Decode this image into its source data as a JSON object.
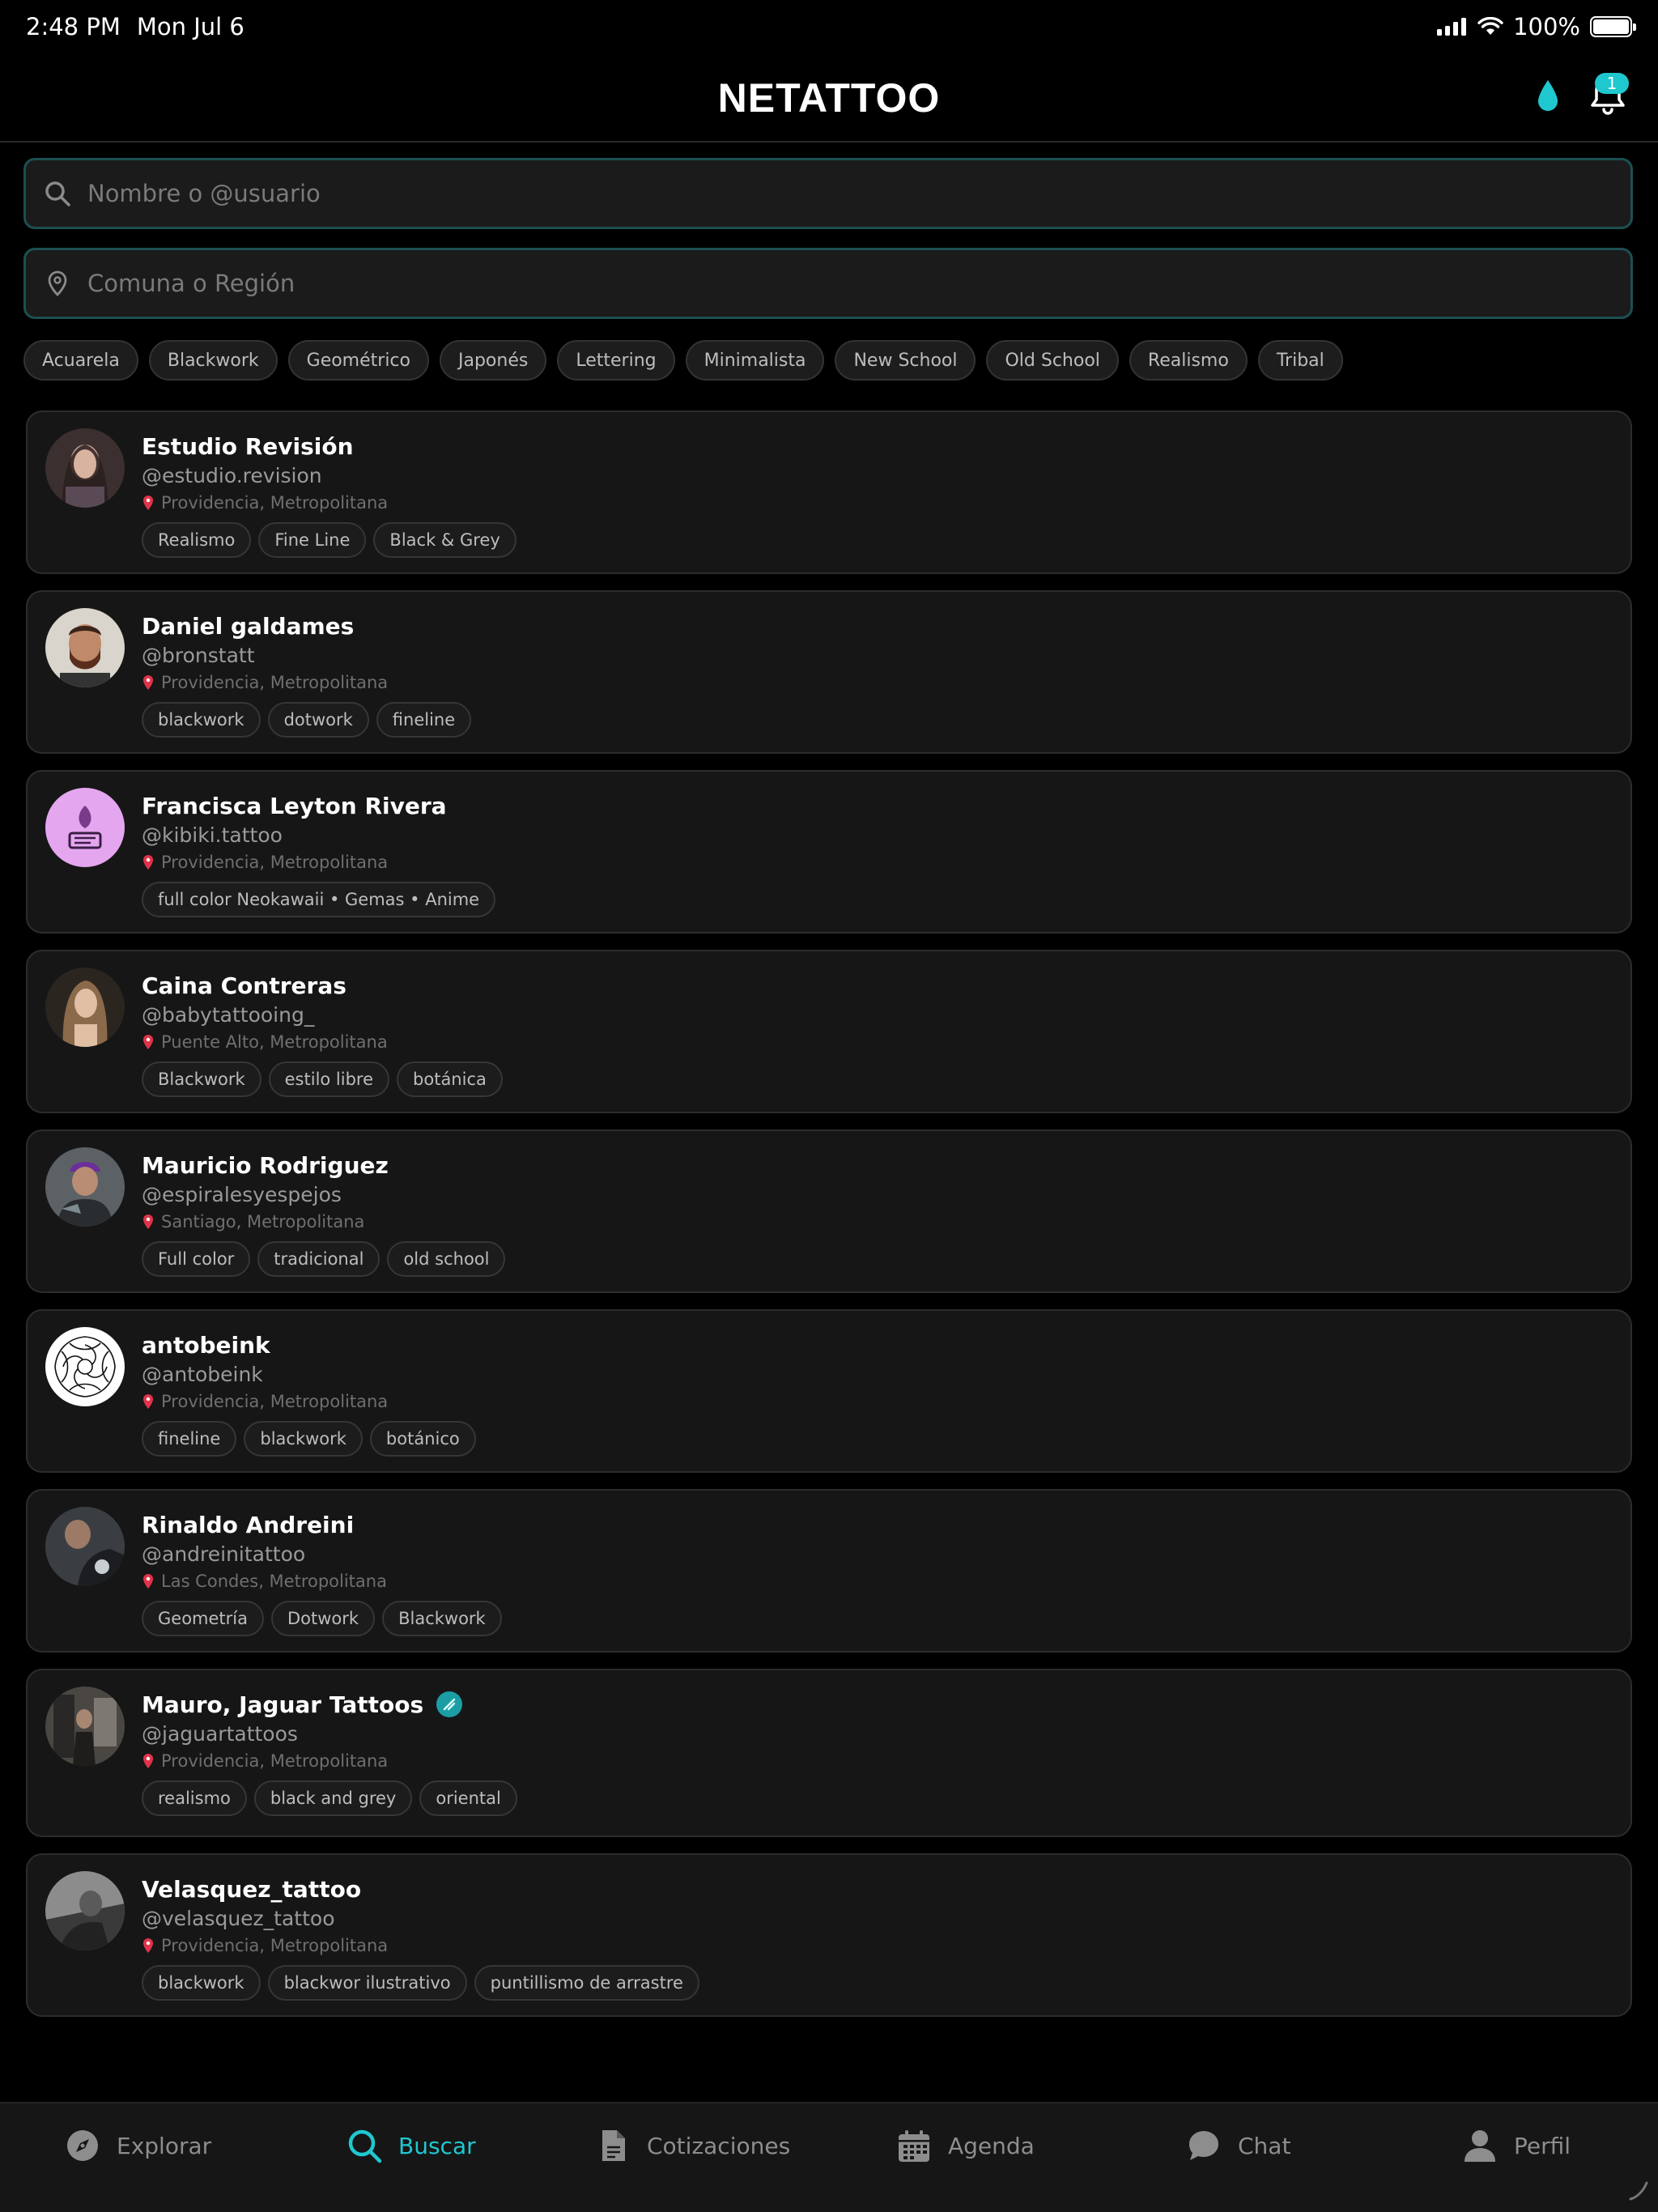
{
  "status_bar": {
    "time": "2:48 PM",
    "date": "Mon Jul 6",
    "battery": "100%"
  },
  "header": {
    "logo": "NETATTOO",
    "notification_count": "1",
    "accent": "#1fc8cf"
  },
  "search": {
    "name_placeholder": "Nombre o @usuario",
    "location_placeholder": "Comuna o Región"
  },
  "filters": [
    "Acuarela",
    "Blackwork",
    "Geométrico",
    "Japonés",
    "Lettering",
    "Minimalista",
    "New School",
    "Old School",
    "Realismo",
    "Tribal"
  ],
  "artists": [
    {
      "name": "Estudio Revisión",
      "handle": "@estudio.revision",
      "location": "Providencia, Metropolitana",
      "tags": [
        "Realismo",
        "Fine Line",
        "Black & Grey"
      ],
      "verified": false
    },
    {
      "name": "Daniel galdames",
      "handle": "@bronstatt",
      "location": "Providencia, Metropolitana",
      "tags": [
        "blackwork",
        "dotwork",
        "fineline"
      ],
      "verified": false
    },
    {
      "name": "Francisca Leyton Rivera",
      "handle": "@kibiki.tattoo",
      "location": "Providencia, Metropolitana",
      "tags": [
        "full color Neokawaii • Gemas • Anime"
      ],
      "verified": false
    },
    {
      "name": "Caina Contreras",
      "handle": "@babytattooing_",
      "location": "Puente Alto, Metropolitana",
      "tags": [
        "Blackwork",
        "estilo libre",
        "botánica"
      ],
      "verified": false
    },
    {
      "name": "Mauricio Rodriguez",
      "handle": "@espiralesyespejos",
      "location": "Santiago, Metropolitana",
      "tags": [
        "Full color",
        "tradicional",
        "old school"
      ],
      "verified": false
    },
    {
      "name": "antobeink",
      "handle": "@antobeink",
      "location": "Providencia, Metropolitana",
      "tags": [
        "fineline",
        "blackwork",
        "botánico"
      ],
      "verified": false
    },
    {
      "name": "Rinaldo Andreini",
      "handle": "@andreinitattoo",
      "location": "Las Condes, Metropolitana",
      "tags": [
        "Geometría",
        "Dotwork",
        "Blackwork"
      ],
      "verified": false
    },
    {
      "name": "Mauro, Jaguar Tattoos",
      "handle": "@jaguartattoos",
      "location": "Providencia, Metropolitana",
      "tags": [
        "realismo",
        "black and grey",
        "oriental"
      ],
      "verified": true
    },
    {
      "name": "Velasquez_tattoo",
      "handle": "@velasquez_tattoo",
      "location": "Providencia, Metropolitana",
      "tags": [
        "blackwork",
        "blackwor ilustrativo",
        "puntillismo de arrastre"
      ],
      "verified": false
    }
  ],
  "tabs": [
    {
      "label": "Explorar",
      "icon": "compass-icon",
      "active": false
    },
    {
      "label": "Buscar",
      "icon": "search-icon",
      "active": true
    },
    {
      "label": "Cotizaciones",
      "icon": "document-icon",
      "active": false
    },
    {
      "label": "Agenda",
      "icon": "calendar-icon",
      "active": false
    },
    {
      "label": "Chat",
      "icon": "chat-icon",
      "active": false
    },
    {
      "label": "Perfil",
      "icon": "person-icon",
      "active": false
    }
  ]
}
